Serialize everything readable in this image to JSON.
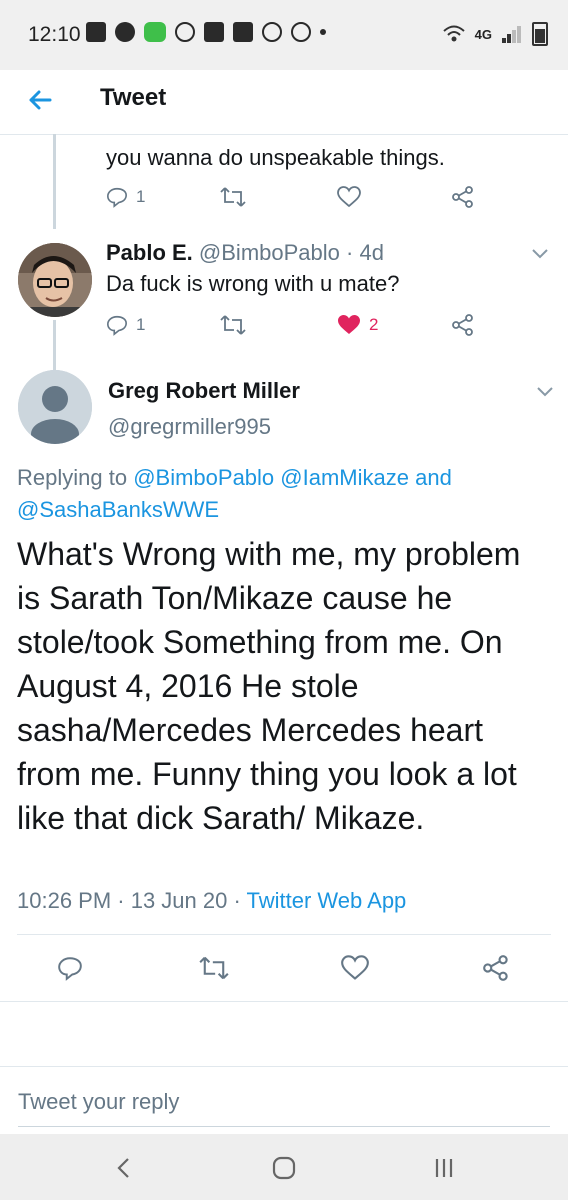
{
  "status_bar": {
    "time": "12:10",
    "network": "4G"
  },
  "header": {
    "title": "Tweet"
  },
  "tweet_above": {
    "text": "you wanna do unspeakable things.",
    "reply_count": "1"
  },
  "tweet_pablo": {
    "name": "Pablo E.",
    "handle": "@BimboPablo",
    "time": "· 4d",
    "text": "Da fuck is wrong with u mate?",
    "reply_count": "1",
    "like_count": "2"
  },
  "main_tweet": {
    "name": "Greg Robert Miller",
    "handle": "@gregrmiller995",
    "replying_prefix": "Replying to",
    "replying_1": "@BimboPablo",
    "replying_2": "@IamMikaze",
    "replying_and": "and",
    "replying_3": "@SashaBanksWWE",
    "text": "What's Wrong with me, my problem is Sarath Ton/Mikaze cause he stole/took Something from me. On August 4, 2016 He stole sasha/Mercedes Mercedes heart from me. Funny thing you look a lot like that dick Sarath/ Mikaze.",
    "timestamp": "10:26 PM · 13 Jun 20 ·",
    "source": "Twitter Web App"
  },
  "reply_box": {
    "placeholder": "Tweet your reply"
  },
  "colors": {
    "accent": "#1b95e0",
    "like_red": "#e0245e",
    "secondary_text": "#657786"
  }
}
